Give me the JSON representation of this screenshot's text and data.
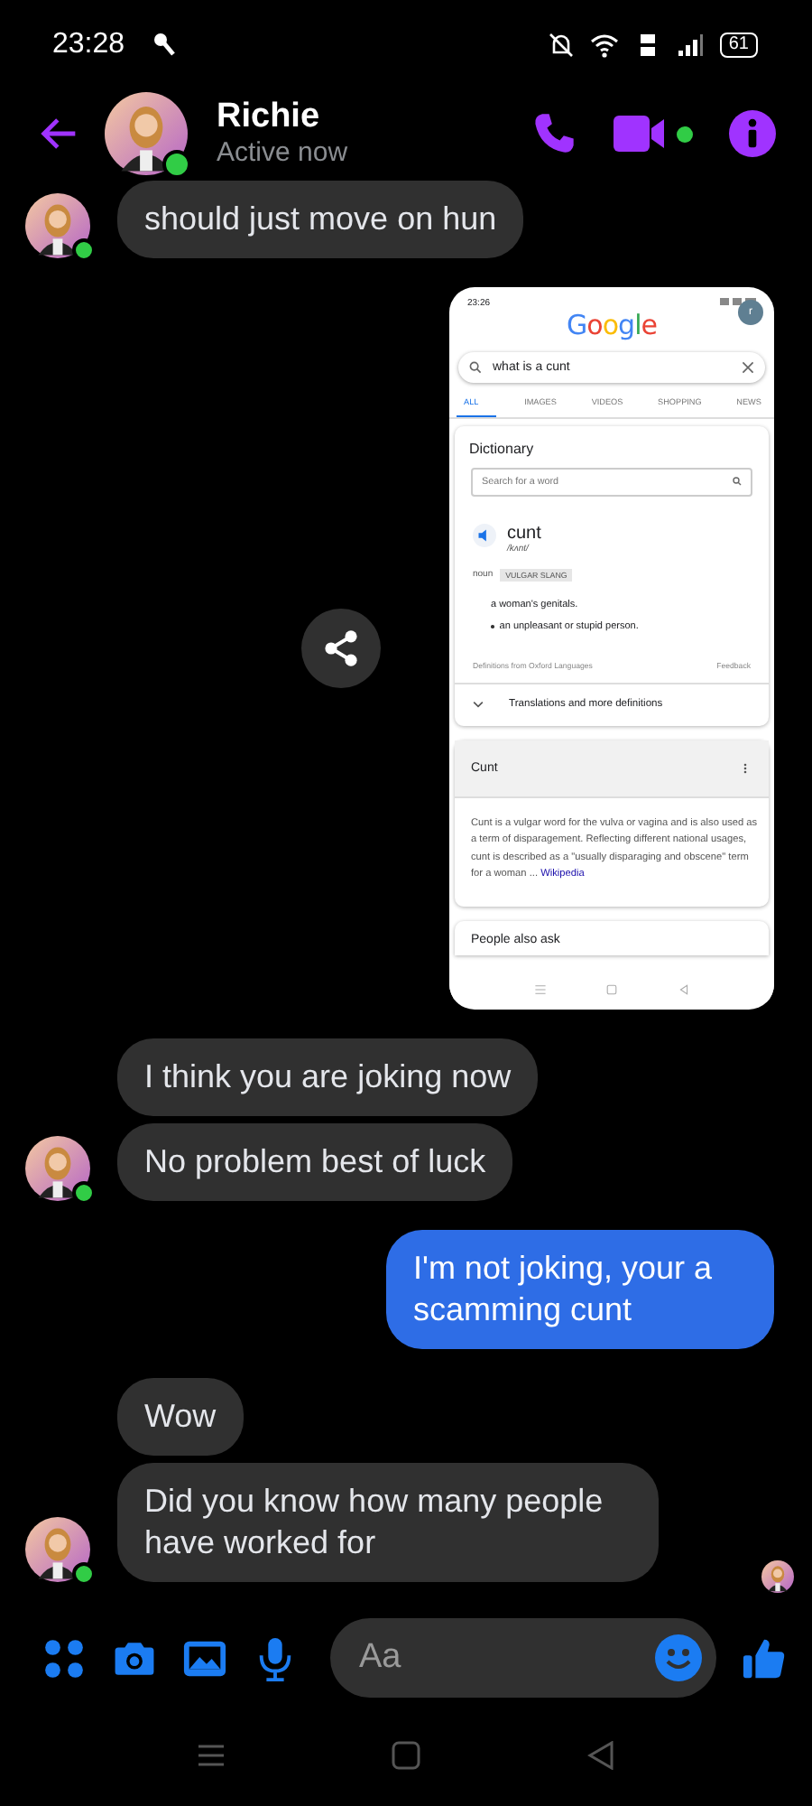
{
  "status_bar": {
    "time": "23:28",
    "battery": "61"
  },
  "header": {
    "name": "Richie",
    "status": "Active now",
    "active": true,
    "video_active": true
  },
  "messages": [
    {
      "kind": "text",
      "outgoing": false,
      "text": "should just move on hun",
      "avatar": true
    },
    {
      "kind": "screenshot",
      "outgoing": true,
      "screenshot": {
        "time": "23:26",
        "logo": "Google",
        "account": "r",
        "query": "what is a cunt",
        "tabs": [
          {
            "label": "ALL",
            "selected": true
          },
          {
            "label": "IMAGES",
            "selected": false
          },
          {
            "label": "VIDEOS",
            "selected": false
          },
          {
            "label": "SHOPPING",
            "selected": false
          },
          {
            "label": "NEWS",
            "selected": false
          }
        ],
        "dictionary": {
          "title": "Dictionary",
          "search_placeholder": "Search for a word",
          "word": "cunt",
          "phonetic": "/kʌnt/",
          "part_of_speech": "noun",
          "tag": "VULGAR SLANG",
          "definitions": [
            {
              "text": "a woman's genitals.",
              "bullet": false
            },
            {
              "text": "an unpleasant or stupid person.",
              "bullet": true
            }
          ],
          "source": "Definitions from Oxford Languages",
          "feedback": "Feedback",
          "more": "Translations and more definitions"
        },
        "wiki": {
          "title": "Cunt",
          "text": "Cunt is a vulgar word for the vulva or vagina and is also used as a term of disparagement. Reflecting different national usages, cunt is described as a \"usually disparaging and obscene\" term for a woman ...",
          "link": "Wikipedia"
        },
        "next_section": "People also ask"
      }
    },
    {
      "kind": "text",
      "outgoing": false,
      "text": "I think you are joking now",
      "avatar": false
    },
    {
      "kind": "text",
      "outgoing": false,
      "text": "No problem best of luck",
      "avatar": true
    },
    {
      "kind": "text",
      "outgoing": true,
      "text": "I'm not joking, your a scamming cunt"
    },
    {
      "kind": "text",
      "outgoing": false,
      "text": "Wow",
      "avatar": false
    },
    {
      "kind": "text",
      "outgoing": false,
      "text": "Did you know how many people have worked for",
      "avatar": true
    }
  ],
  "seen": true,
  "composer": {
    "placeholder": "Aa"
  }
}
